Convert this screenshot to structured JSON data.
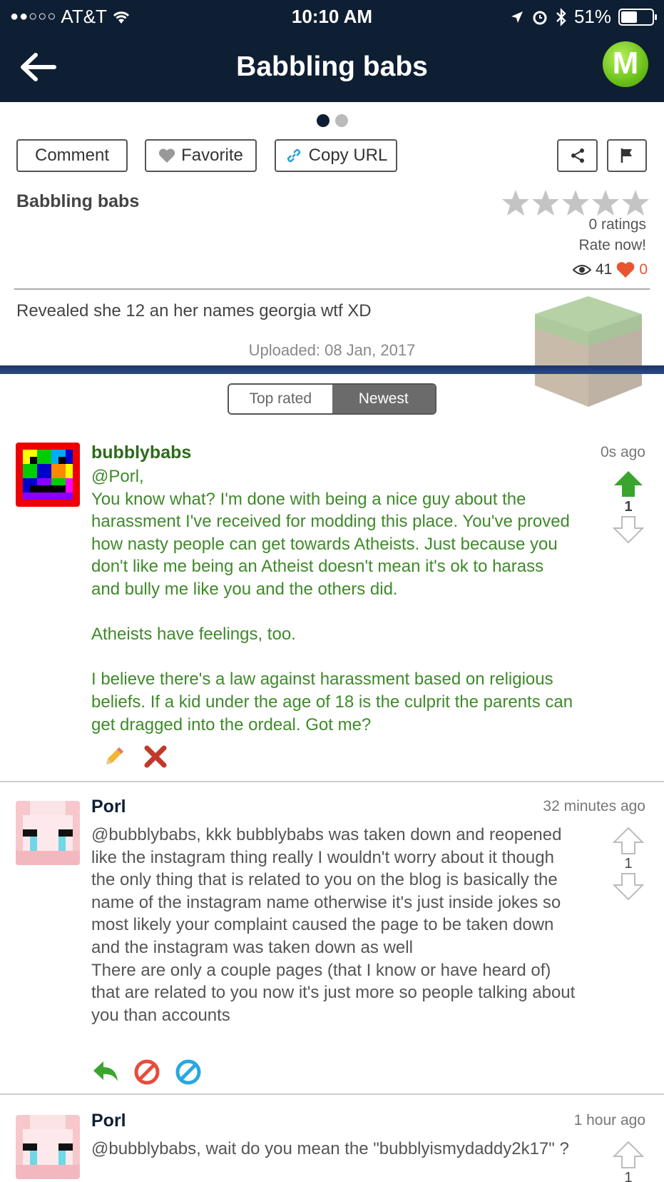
{
  "status_bar": {
    "carrier": "AT&T",
    "time": "10:10 AM",
    "battery": "51%",
    "battery_level": 0.51
  },
  "nav": {
    "title": "Babbling babs",
    "back_icon": "arrow-left-icon",
    "logo_letter": "M"
  },
  "actions": {
    "comment": "Comment",
    "favorite": "Favorite",
    "copy_url": "Copy URL"
  },
  "post": {
    "title": "Babbling babs",
    "rating_stars": 0,
    "ratings_text": "0 ratings",
    "rate_now": "Rate now!",
    "views": "41",
    "likes": "0",
    "description": "Revealed she 12 an her names georgia wtf XD",
    "uploaded": "Uploaded: 08 Jan, 2017"
  },
  "tabs": {
    "top_rated": "Top rated",
    "newest": "Newest",
    "active": "Newest"
  },
  "comments": [
    {
      "author": "bubblybabs",
      "time": "0s ago",
      "score": "1",
      "upvoted": true,
      "body": "@Porl,\nYou know what? I'm done with being a nice guy about the harassment I've received for modding this place. You've proved how nasty people can get towards Atheists. Just because you don't like me being an Atheist doesn't mean it's ok to harass and bully me like you and the others did.\n\nAtheists have feelings, too.\n\nI believe there's a law against harassment based on religious beliefs. If a kid under the age of 18 is the culprit the parents can get dragged into the ordeal. Got me?"
    },
    {
      "author": "Porl",
      "time": "32 minutes ago",
      "score": "1",
      "upvoted": false,
      "body": "@bubblybabs, kkk bubblybabs was taken down and reopened like the instagram thing really I wouldn't worry about it though the only thing that is related to you on the blog is basically the name of the instagram name otherwise it's just inside jokes so most likely your complaint caused the page to be taken down and the instagram was taken down as well\nThere are only a couple pages (that I know or have heard of) that are related to you now it's just more so people talking about you than accounts"
    },
    {
      "author": "Porl",
      "time": "1 hour ago",
      "score": "1",
      "upvoted": false,
      "body": "@bubblybabs, wait do you mean the \"bubblyismydaddy2k17\" ?"
    }
  ],
  "colors": {
    "nav_bg": "#0e1f33",
    "accent_green": "#3f8a2a",
    "like_red": "#e8552e",
    "logo_green": "#6cc11a"
  }
}
